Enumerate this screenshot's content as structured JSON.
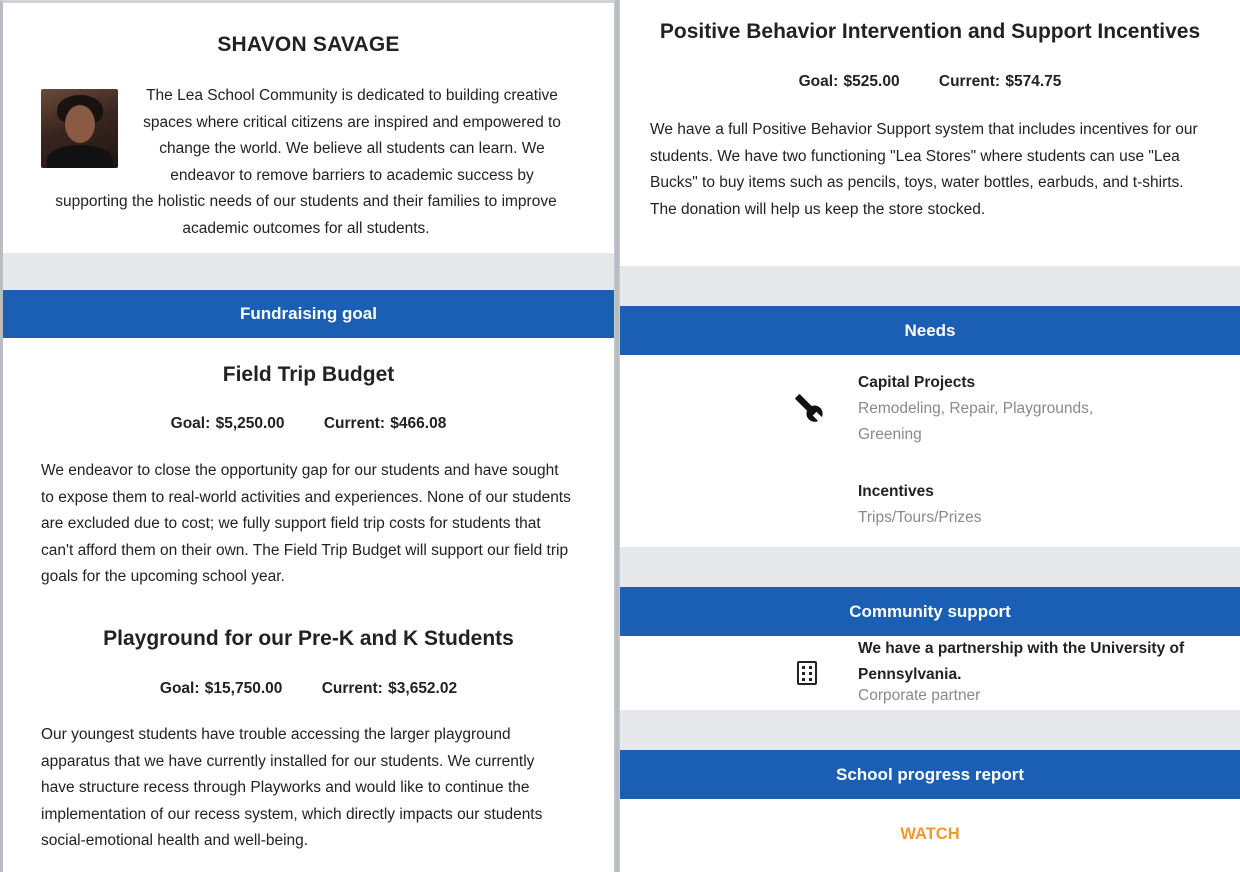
{
  "profile": {
    "name": "SHAVON SAVAGE",
    "bio": "The Lea School Community is dedicated to building creative spaces where critical citizens are inspired and empowered to change the world. We believe all students can learn. We endeavor to remove barriers to academic success by supporting the holistic needs of our students and their families to improve academic outcomes for all students."
  },
  "fundraising": {
    "banner": "Fundraising goal",
    "goals": [
      {
        "title": "Field Trip Budget",
        "goal": "Goal: $5,250.00",
        "current": "Current: $466.08",
        "description": "We endeavor to close the opportunity gap for our students and have sought to expose them to real-world activities and experiences. None of our students are excluded due to cost; we fully support field trip costs for students that can't afford them on their own. The Field Trip Budget will support our field trip goals for the upcoming school year."
      },
      {
        "title": "Playground for our Pre-K and K Students",
        "goal": "Goal: $15,750.00",
        "current": "Current: $3,652.02",
        "description": "Our youngest students have trouble accessing the larger playground apparatus that we have currently installed for our students. We currently have structure recess through Playworks and would like to continue the implementation of our recess system, which directly impacts our students social-emotional health and well-being."
      },
      {
        "title": "Positive Behavior Intervention and Support Incentives",
        "goal": "Goal: $525.00",
        "current": "Current: $574.75",
        "description": "We have a full Positive Behavior Support system that includes incentives for our students. We have two functioning \"Lea Stores\" where students can use \"Lea Bucks\" to buy items such as pencils, toys, water bottles, earbuds, and t-shirts. The donation will help us keep the store stocked."
      }
    ]
  },
  "needs": {
    "banner": "Needs",
    "items": [
      {
        "title": "Capital Projects",
        "subtitle": "Remodeling, Repair, Playgrounds, Greening",
        "icon": "wrench-icon"
      },
      {
        "title": "Incentives",
        "subtitle": "Trips/Tours/Prizes"
      }
    ]
  },
  "community": {
    "banner": "Community support",
    "title": "We have a partnership with the University of Pennsylvania.",
    "subtitle": "Corporate partner",
    "icon": "building-icon"
  },
  "progress_report": {
    "banner": "School progress report",
    "link": "WATCH"
  },
  "colors": {
    "banner": "#1a5fb4",
    "link": "#f0982d",
    "muted_text": "#8a8a8a"
  }
}
